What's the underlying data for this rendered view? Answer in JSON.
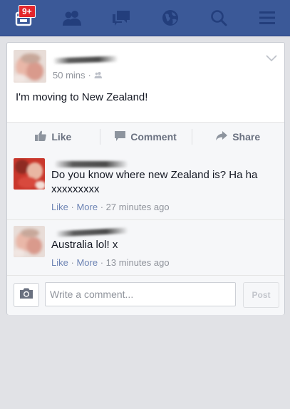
{
  "navbar": {
    "notification_count": "9+",
    "icons": [
      "notifications-icon",
      "friends-icon",
      "messages-icon",
      "globe-icon",
      "search-icon",
      "menu-icon"
    ],
    "background": "#3b5998",
    "icon_color": "#233e7c"
  },
  "post": {
    "timestamp": "50 mins",
    "separator": "·",
    "privacy_icon": "friends-audience-icon",
    "status_text": "I'm moving to New Zealand!",
    "actions": {
      "like": "Like",
      "comment": "Comment",
      "share": "Share"
    }
  },
  "comments": [
    {
      "text": "Do you know where new Zealand is? Ha ha xxxxxxxxx",
      "like_label": "Like",
      "more_label": "More",
      "dot": "·",
      "time": "27 minutes ago"
    },
    {
      "text": "Australia lol! x",
      "like_label": "Like",
      "more_label": "More",
      "dot": "·",
      "time": "13 minutes ago"
    }
  ],
  "composer": {
    "placeholder": "Write a comment...",
    "post_label": "Post"
  }
}
